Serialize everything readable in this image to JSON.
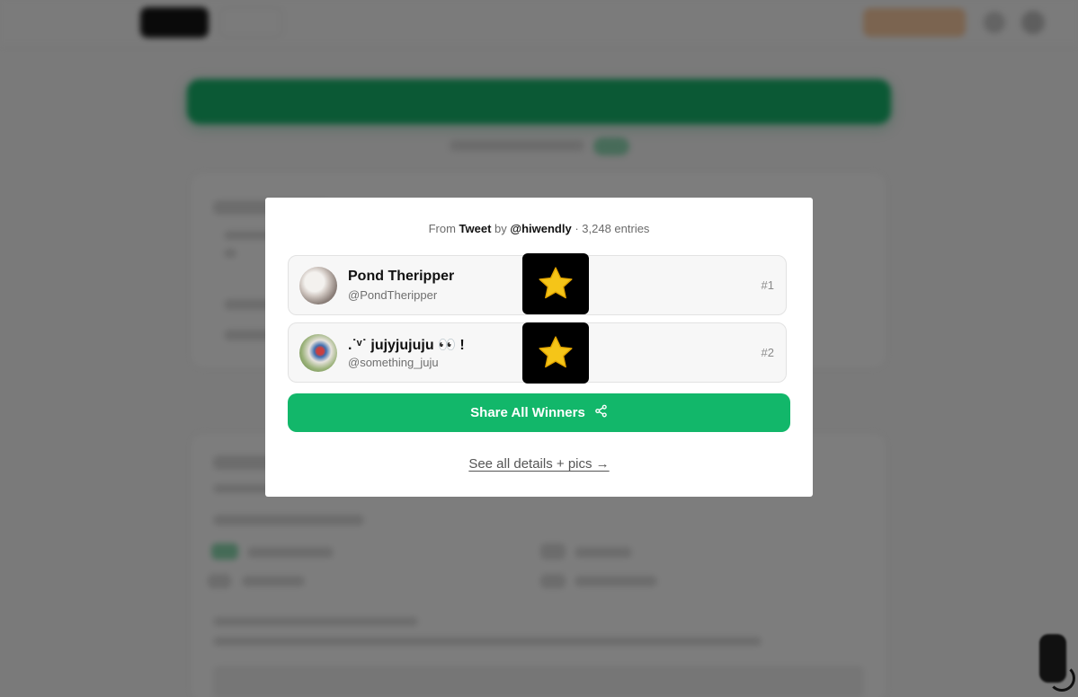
{
  "background": {
    "logo": "",
    "nav": [
      "",
      ""
    ],
    "cta_label": ""
  },
  "modal": {
    "source": {
      "prefix": "From",
      "type": "Tweet",
      "by": "by",
      "author": "@hiwendly",
      "entries": "· 3,248 entries"
    },
    "winners": [
      {
        "name": "Pond Theripper",
        "handle": "@PondTheripper",
        "rank": "#1",
        "badge_icon": "star-icon"
      },
      {
        "name": ".˙ᵛ˙ jujyjujuju 👀 !",
        "handle": "@something_juju",
        "rank": "#2",
        "badge_icon": "star-icon"
      }
    ],
    "share_label": "Share All Winners",
    "details_link": "See all details + pics →"
  },
  "colors": {
    "accent": "#12b76a",
    "star": "#f5c518",
    "overlay": "rgba(0,0,0,0.5)"
  }
}
